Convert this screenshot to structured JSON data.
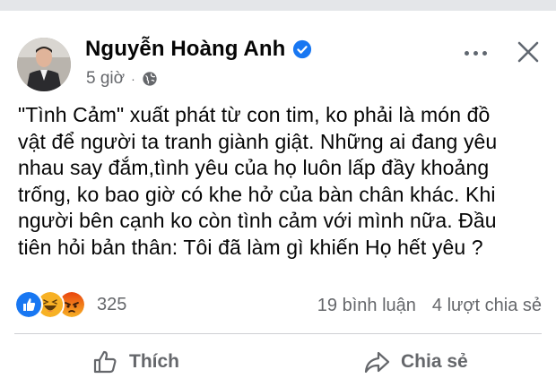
{
  "post": {
    "author_name": "Nguyễn Hoàng Anh",
    "time": "5 giờ",
    "separator": "·",
    "icons": {
      "verified": "verified-badge-icon",
      "audience": "globe-icon",
      "more": "more-options-icon",
      "close": "close-icon"
    },
    "text_lines": [
      "\"Tình Cảm\" xuất phát từ con tim,  ko phải là món đồ",
      "vật để người ta tranh giành giật. Những ai đang yêu",
      "nhau say đắm,tình yêu của họ luôn lấp đầy khoảng",
      "trống, ko bao giờ có khe hở của bàn chân khác. Khi",
      "người bên cạnh ko còn tình cảm với mình nữa. Đầu",
      "tiên hỏi bản thân: Tôi đã làm gì khiến Họ hết yêu ?"
    ]
  },
  "engagement": {
    "reaction_icons": [
      "like-reaction-icon",
      "haha-reaction-icon",
      "angry-reaction-icon"
    ],
    "reaction_count": "325",
    "comments": "19 bình luận",
    "shares": "4 lượt chia sẻ"
  },
  "actions": {
    "like_label": "Thích",
    "share_label": "Chia sẻ"
  },
  "colors": {
    "verified": "#1877f2",
    "secondary_text": "#65676b",
    "like": "#1877f2",
    "haha": "#f7b125",
    "angry": "#e9710f"
  }
}
